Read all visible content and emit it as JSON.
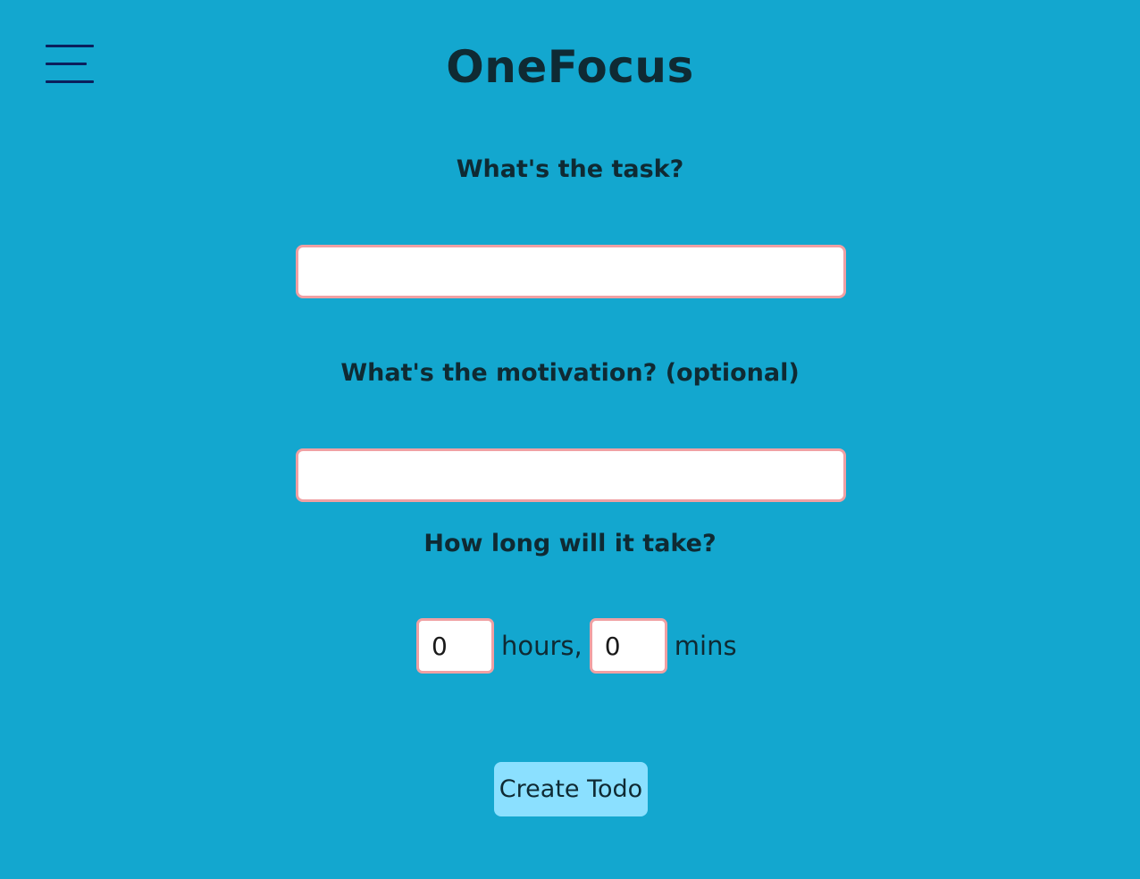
{
  "app": {
    "title": "OneFocus"
  },
  "menu": {
    "icon": "hamburger-menu-icon"
  },
  "form": {
    "task_label": "What's the task?",
    "task_value": "",
    "motivation_label": "What's the motivation? (optional)",
    "motivation_value": "",
    "duration_label": "How long will it take?",
    "hours_value": "0",
    "hours_unit": "hours,",
    "mins_value": "0",
    "mins_unit": "mins",
    "submit_label": "Create Todo"
  },
  "colors": {
    "background": "#13a7cf",
    "input_border": "#f0a0a3",
    "button_bg": "#8be0ff",
    "text": "#0f2a33",
    "menu_icon": "#0b1f5c"
  }
}
